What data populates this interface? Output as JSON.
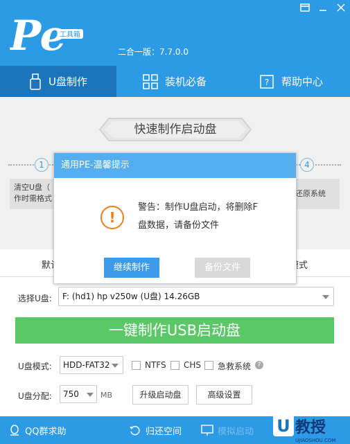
{
  "app": {
    "version_label": "二合一版：7.7.0.0",
    "logo_badge": "工具箱"
  },
  "window_controls": {
    "menu_icon": "menu-icon",
    "minimize_icon": "minimize-icon",
    "close_icon": "close-icon"
  },
  "tabs": [
    {
      "label": "U盘制作",
      "icon": "usb-icon",
      "active": true
    },
    {
      "label": "装机必备",
      "icon": "grid-icon",
      "active": false
    },
    {
      "label": "帮助中心",
      "icon": "help-book-icon",
      "active": false
    }
  ],
  "content": {
    "banner_title": "快速制作启动盘",
    "steps": [
      {
        "number": "1",
        "text_line1": "清空U盘（",
        "text_line2": "作时需格式"
      },
      {
        "number": "4",
        "text_line1": "还原系统",
        "text_line2": ""
      }
    ]
  },
  "mode_tabs": {
    "left": "默认",
    "right": "模式"
  },
  "form": {
    "usb_select_label": "选择U盘:",
    "usb_select_value": "F: (hd1) hp v250w  (U盘) 14.26GB",
    "make_button": "一键制作USB启动盘",
    "mode_label": "U盘模式:",
    "mode_value": "HDD-FAT32",
    "ntfs_label": "NTFS",
    "chs_label": "CHS",
    "emergency_label": "急救系统",
    "partition_label": "U盘分配:",
    "partition_value": "750",
    "partition_unit": "MB",
    "upgrade_button": "升级启动盘",
    "advanced_button": "高级设置"
  },
  "footer": {
    "qq_label": "QQ群求助",
    "restore_label": "归还空间",
    "simulate_label": "模拟启动"
  },
  "watermark": {
    "text": "U教授",
    "url": "UJIAOSHOU.COM"
  },
  "dialog": {
    "title": "通用PE-温馨提示",
    "message_line1": "警告：制作U盘启动，将删除F",
    "message_line2": "盘数据，请备份文件",
    "continue_button": "继续制作",
    "backup_button": "备份文件"
  },
  "colors": {
    "primary": "#2d9ae6",
    "active_tab": "#1b75bc",
    "make_button": "#5ac866",
    "dialog_title": "#54aef0",
    "warning": "#f07d1b"
  }
}
